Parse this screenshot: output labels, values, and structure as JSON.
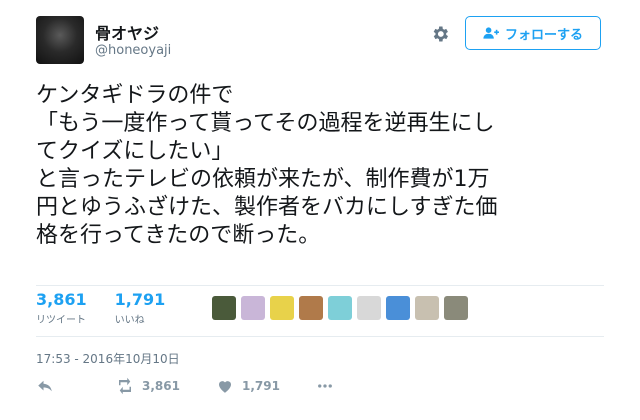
{
  "user": {
    "name": "骨オヤジ",
    "handle": "@honeoyaji"
  },
  "follow_button": {
    "label": "フォローする",
    "icon": "add-user-icon"
  },
  "settings": {
    "icon": "gear-icon"
  },
  "tweet": {
    "text": "ケンタギドラの件で\n「もう一度作って貰ってその過程を逆再生にし\nてクイズにしたい」\nと言ったテレビの依頼が来たが、制作費が1万\n円とゆうふざけた、製作者をバカにしすぎた価\n格を行ってきたので断った。"
  },
  "stats": {
    "retweets": {
      "count": "3,861",
      "label": "リツイート"
    },
    "likes": {
      "count": "1,791",
      "label": "いいね"
    }
  },
  "likers": [
    {
      "color": "#4a5a3a"
    },
    {
      "color": "#c9b6d8"
    },
    {
      "color": "#e8d24a"
    },
    {
      "color": "#b07a4a"
    },
    {
      "color": "#7ecfd8"
    },
    {
      "color": "#d8d8d8"
    },
    {
      "color": "#4a8fd8"
    },
    {
      "color": "#c8c0b0"
    },
    {
      "color": "#8a8a7a"
    }
  ],
  "timestamp": "17:53 - 2016年10月10日",
  "actions": {
    "reply_icon": "reply-icon",
    "retweet_icon": "retweet-icon",
    "retweet_count": "3,861",
    "like_icon": "heart-icon",
    "like_count": "1,791",
    "more_icon": "more-icon"
  },
  "colors": {
    "accent": "#1da1f2",
    "muted": "#657786",
    "icon": "#8899a6"
  }
}
